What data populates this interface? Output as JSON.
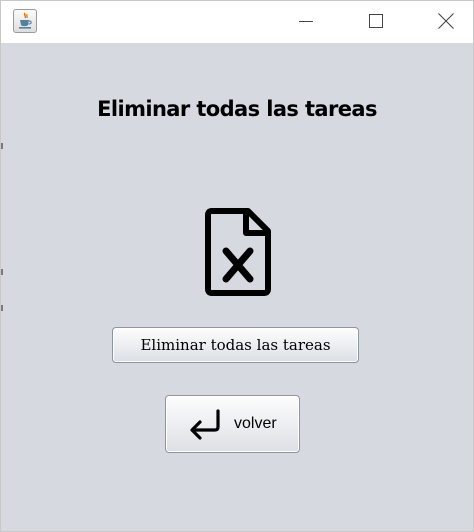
{
  "window": {
    "app_icon": "java-cup-icon",
    "controls": [
      "minimize-icon",
      "maximize-icon",
      "close-icon"
    ]
  },
  "main": {
    "heading": "Eliminar todas las tareas",
    "file_icon": "file-delete-icon",
    "delete_all_button": {
      "label": "Eliminar todas las tareas"
    },
    "back_button": {
      "label": "volver",
      "icon": "return-arrow-icon"
    }
  },
  "colors": {
    "titlebar_bg": "#ffffff",
    "content_bg": "#d6d9e0",
    "button_border": "#8e95a0",
    "text": "#000000"
  }
}
